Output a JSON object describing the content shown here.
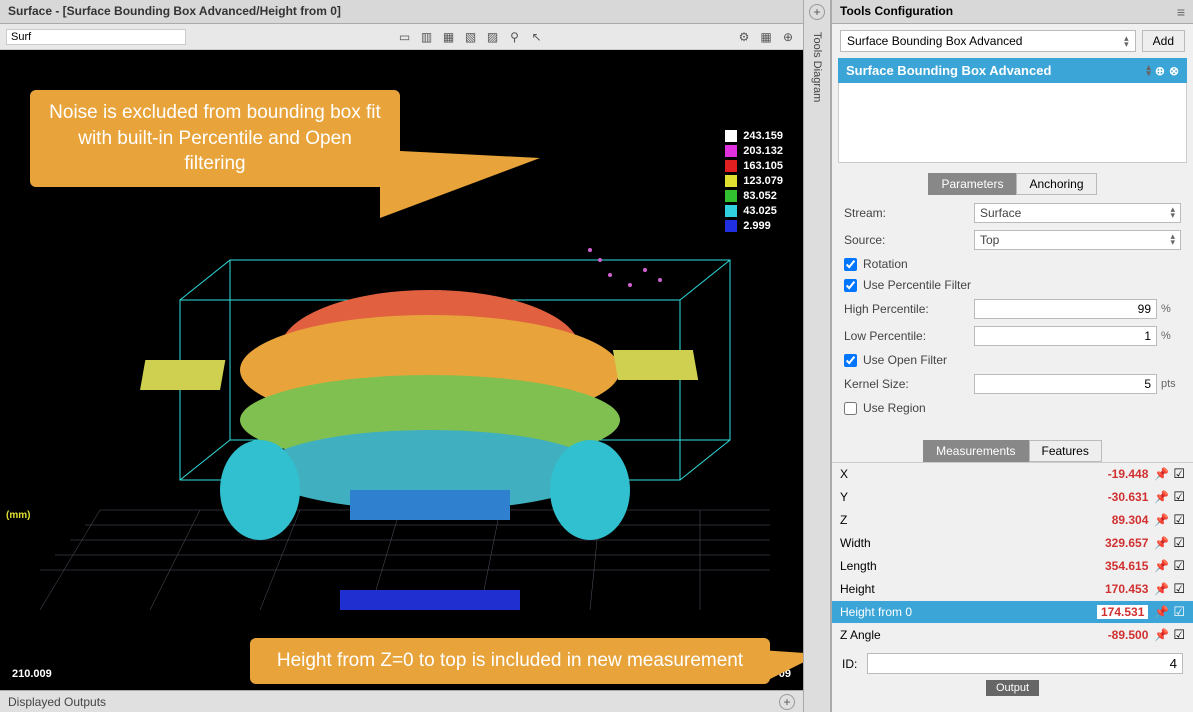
{
  "title": "Surface - [Surface Bounding Box Advanced/Height from 0]",
  "toolbar": {
    "surf_label": "Surf"
  },
  "legend": [
    {
      "color": "#FFFFFF",
      "value": "243.159"
    },
    {
      "color": "#E030E0",
      "value": "203.132"
    },
    {
      "color": "#E02020",
      "value": "163.105"
    },
    {
      "color": "#E0E030",
      "value": "123.079"
    },
    {
      "color": "#30C030",
      "value": "83.052"
    },
    {
      "color": "#30D0E0",
      "value": "43.025"
    },
    {
      "color": "#2030E0",
      "value": "2.999"
    }
  ],
  "mm_label": "(mm)",
  "coord_bl": "210.009",
  "coord_br": "09",
  "callout1": "Noise is excluded from bounding box fit with built-in Percentile and Open filtering",
  "callout2": "Height from Z=0 to top is included in new measurement",
  "footer_label": "Displayed Outputs",
  "divider_label": "Tools Diagram",
  "panel": {
    "title": "Tools Configuration",
    "tool_select": "Surface Bounding Box Advanced",
    "add_label": "Add",
    "tool_header": "Surface Bounding Box Advanced",
    "tabs1": {
      "parameters": "Parameters",
      "anchoring": "Anchoring"
    },
    "params": {
      "stream_label": "Stream:",
      "stream_value": "Surface",
      "source_label": "Source:",
      "source_value": "Top",
      "rotation_label": "Rotation",
      "percentile_filter_label": "Use Percentile Filter",
      "high_percentile_label": "High Percentile:",
      "high_percentile_value": "99",
      "low_percentile_label": "Low Percentile:",
      "low_percentile_value": "1",
      "pct_unit": "%",
      "open_filter_label": "Use Open Filter",
      "kernel_label": "Kernel Size:",
      "kernel_value": "5",
      "pts_unit": "pts",
      "use_region_label": "Use Region"
    },
    "tabs2": {
      "measurements": "Measurements",
      "features": "Features"
    },
    "measurements": [
      {
        "label": "X",
        "value": "-19.448",
        "selected": false
      },
      {
        "label": "Y",
        "value": "-30.631",
        "selected": false
      },
      {
        "label": "Z",
        "value": "89.304",
        "selected": false
      },
      {
        "label": "Width",
        "value": "329.657",
        "selected": false
      },
      {
        "label": "Length",
        "value": "354.615",
        "selected": false
      },
      {
        "label": "Height",
        "value": "170.453",
        "selected": false
      },
      {
        "label": "Height from 0",
        "value": "174.531",
        "selected": true
      },
      {
        "label": "Z Angle",
        "value": "-89.500",
        "selected": false
      }
    ],
    "id_label": "ID:",
    "id_value": "4",
    "output_label": "Output"
  }
}
